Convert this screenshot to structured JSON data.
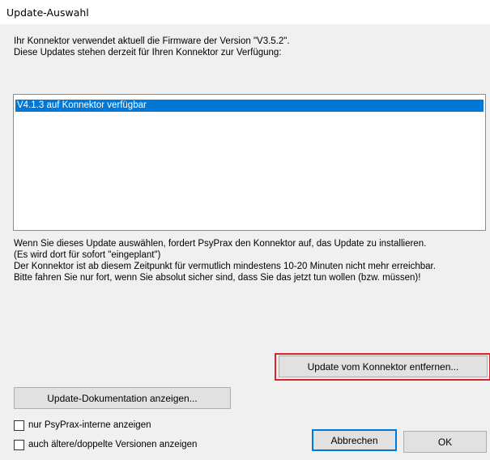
{
  "window": {
    "title": "Update-Auswahl"
  },
  "intro": {
    "line1": "Ihr Konnektor verwendet aktuell die Firmware der Version \"V3.5.2\".",
    "line2": "Diese Updates stehen derzeit für Ihren Konnektor zur Verfügung:"
  },
  "updates_list": {
    "items": [
      {
        "label": "V4.1.3 auf Konnektor verfügbar",
        "selected": true
      }
    ]
  },
  "warning": {
    "line1": "Wenn Sie dieses Update auswählen, fordert PsyPrax den Konnektor auf, das Update zu installieren.",
    "line2": "(Es wird dort für sofort \"eingeplant\")",
    "line3": "Der Konnektor ist ab diesem Zeitpunkt für vermutlich mindestens 10-20 Minuten nicht mehr erreichbar.",
    "line4": "Bitte fahren Sie nur fort, wenn Sie absolut sicher sind, dass Sie das jetzt tun wollen (bzw. müssen)!"
  },
  "buttons": {
    "remove_update": "Update vom Konnektor entfernen...",
    "show_docs": "Update-Dokumentation anzeigen...",
    "cancel": "Abbrechen",
    "ok": "OK"
  },
  "checkboxes": {
    "internal_only": {
      "label": "nur PsyPrax-interne anzeigen",
      "checked": false
    },
    "older_versions": {
      "label": "auch ältere/doppelte Versionen anzeigen",
      "checked": false
    }
  },
  "colors": {
    "selection": "#0078d7",
    "highlight_border": "#d9232f",
    "dialog_background": "#f0f0f0",
    "button_face": "#e1e1e1"
  }
}
